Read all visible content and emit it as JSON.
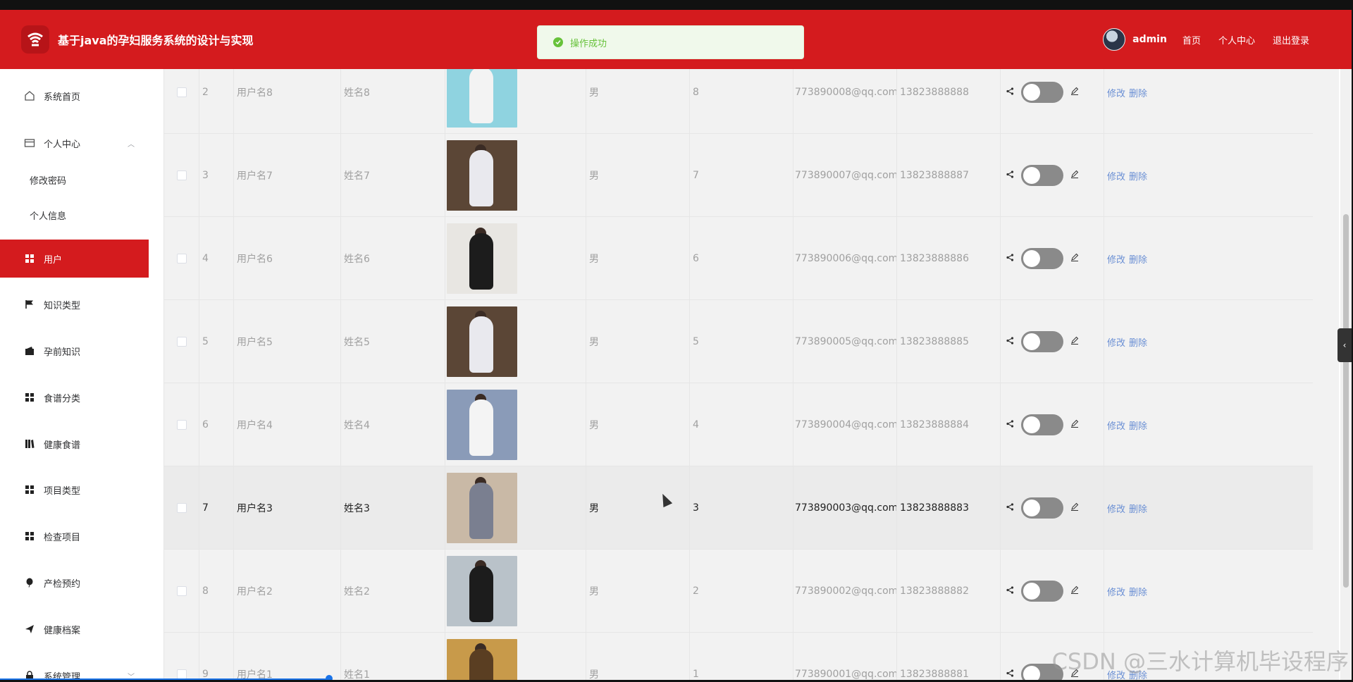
{
  "app": {
    "title": "基于java的孕妇服务系统的设计与实现",
    "brand_color": "#d41b1e"
  },
  "toast": {
    "message": "操作成功",
    "icon": "success-check-icon",
    "color": "#67c23a"
  },
  "header": {
    "username": "admin",
    "links": [
      "首页",
      "个人中心",
      "退出登录"
    ]
  },
  "sidebar": {
    "items": [
      {
        "label": "系统首页",
        "icon": "home-icon"
      },
      {
        "label": "个人中心",
        "icon": "card-icon",
        "expanded": true,
        "children": [
          "修改密码",
          "个人信息"
        ]
      },
      {
        "label": "用户",
        "icon": "grid-icon",
        "active": true
      },
      {
        "label": "知识类型",
        "icon": "flag-icon"
      },
      {
        "label": "孕前知识",
        "icon": "wallet-icon"
      },
      {
        "label": "食谱分类",
        "icon": "grid-icon"
      },
      {
        "label": "健康食谱",
        "icon": "book-icon"
      },
      {
        "label": "项目类型",
        "icon": "grid-icon"
      },
      {
        "label": "检查项目",
        "icon": "grid-icon"
      },
      {
        "label": "产检预约",
        "icon": "balloon-icon"
      },
      {
        "label": "健康档案",
        "icon": "send-icon"
      },
      {
        "label": "系统管理",
        "icon": "lock-icon",
        "expanded": false
      }
    ]
  },
  "table": {
    "actions": {
      "edit": "修改",
      "delete": "删除"
    },
    "rows": [
      {
        "idx": "2",
        "user": "用户名8",
        "name": "姓名8",
        "sex": "男",
        "age": "8",
        "email": "773890008@qq.com",
        "phone": "13823888888",
        "img_bg": "#8fd3e0",
        "img_fig": "#f3f3f3"
      },
      {
        "idx": "3",
        "user": "用户名7",
        "name": "姓名7",
        "sex": "男",
        "age": "7",
        "email": "773890007@qq.com",
        "phone": "13823888887",
        "img_bg": "#5b4636",
        "img_fig": "#e9e9ee"
      },
      {
        "idx": "4",
        "user": "用户名6",
        "name": "姓名6",
        "sex": "男",
        "age": "6",
        "email": "773890006@qq.com",
        "phone": "13823888886",
        "img_bg": "#e8e6e2",
        "img_fig": "#1c1c1c"
      },
      {
        "idx": "5",
        "user": "用户名5",
        "name": "姓名5",
        "sex": "男",
        "age": "5",
        "email": "773890005@qq.com",
        "phone": "13823888885",
        "img_bg": "#5b4636",
        "img_fig": "#e9e9ee"
      },
      {
        "idx": "6",
        "user": "用户名4",
        "name": "姓名4",
        "sex": "男",
        "age": "4",
        "email": "773890004@qq.com",
        "phone": "13823888884",
        "img_bg": "#8a9bb8",
        "img_fig": "#f4f4f4"
      },
      {
        "idx": "7",
        "user": "用户名3",
        "name": "姓名3",
        "sex": "男",
        "age": "3",
        "email": "773890003@qq.com",
        "phone": "13823888883",
        "img_bg": "#c9b9a6",
        "img_fig": "#7a7f90",
        "highlight": true
      },
      {
        "idx": "8",
        "user": "用户名2",
        "name": "姓名2",
        "sex": "男",
        "age": "2",
        "email": "773890002@qq.com",
        "phone": "13823888882",
        "img_bg": "#b9c2c9",
        "img_fig": "#1c1c1c"
      },
      {
        "idx": "9",
        "user": "用户名1",
        "name": "姓名1",
        "sex": "男",
        "age": "1",
        "email": "773890001@qq.com",
        "phone": "13823888881",
        "img_bg": "#c89a4a",
        "img_fig": "#5a3e22"
      }
    ]
  },
  "watermark": "CSDN @三水计算机毕设程序"
}
